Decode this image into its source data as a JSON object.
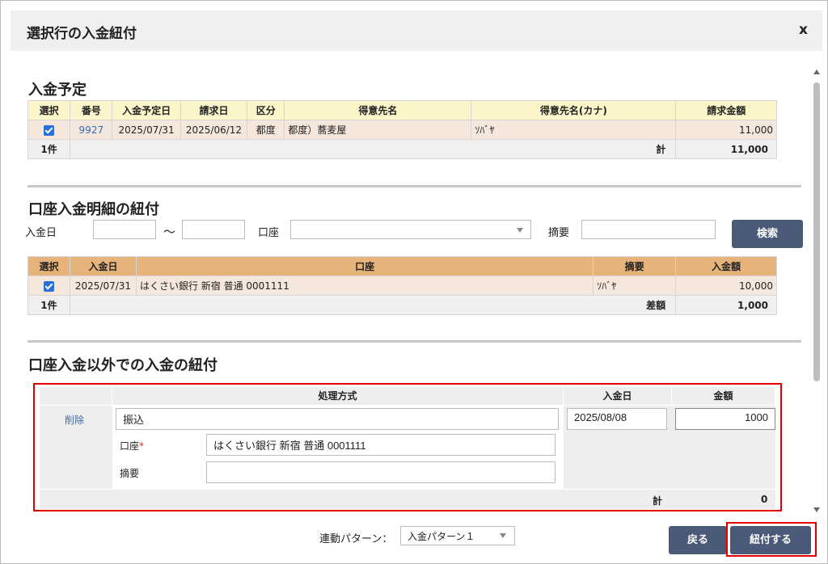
{
  "modal": {
    "title": "選択行の入金紐付",
    "close_label": "x"
  },
  "section1": {
    "title": "入金予定",
    "headers": [
      "選択",
      "番号",
      "入金予定日",
      "請求日",
      "区分",
      "得意先名",
      "得意先名(カナ)",
      "請求金額"
    ],
    "row": {
      "number": "9927",
      "due_date": "2025/07/31",
      "invoice_date": "2025/06/12",
      "category": "都度",
      "customer": "都度）蕎麦屋",
      "customer_kana": "ｿﾊﾞﾔ",
      "amount": "11,000"
    },
    "footer": {
      "count": "1件",
      "total_label": "計",
      "total": "11,000"
    }
  },
  "section2": {
    "title": "口座入金明細の紐付",
    "filters": {
      "date_label": "入金日",
      "tilde": "～",
      "account_label": "口座",
      "summary_label": "摘要",
      "search_button": "検索"
    },
    "headers": [
      "選択",
      "入金日",
      "口座",
      "摘要",
      "入金額"
    ],
    "row": {
      "date": "2025/07/31",
      "account": "はくさい銀行 新宿 普通 0001111",
      "summary": "ｿﾊﾞﾔ",
      "amount": "10,000"
    },
    "footer": {
      "count": "1件",
      "diff_label": "差額",
      "diff": "1,000"
    }
  },
  "section3": {
    "title": "口座入金以外での入金の紐付",
    "headers": [
      "処理方式",
      "入金日",
      "金額"
    ],
    "row": {
      "delete_label": "削除",
      "method": "振込",
      "account_label": "口座",
      "required_mark": "*",
      "account_value": "はくさい銀行 新宿 普通 0001111",
      "summary_label": "摘要",
      "summary_value": "",
      "date": "2025/08/08",
      "amount": "1000"
    },
    "footer": {
      "total_label": "計",
      "total": "0"
    }
  },
  "bottom": {
    "pattern_label": "連動パターン：",
    "pattern_value": "入金パターン１",
    "back_button": "戻る",
    "link_button": "紐付する"
  },
  "colors": {
    "accent_button": "#4a5a78",
    "highlight": "#e00000",
    "checkbox": "#2a6fd6"
  }
}
